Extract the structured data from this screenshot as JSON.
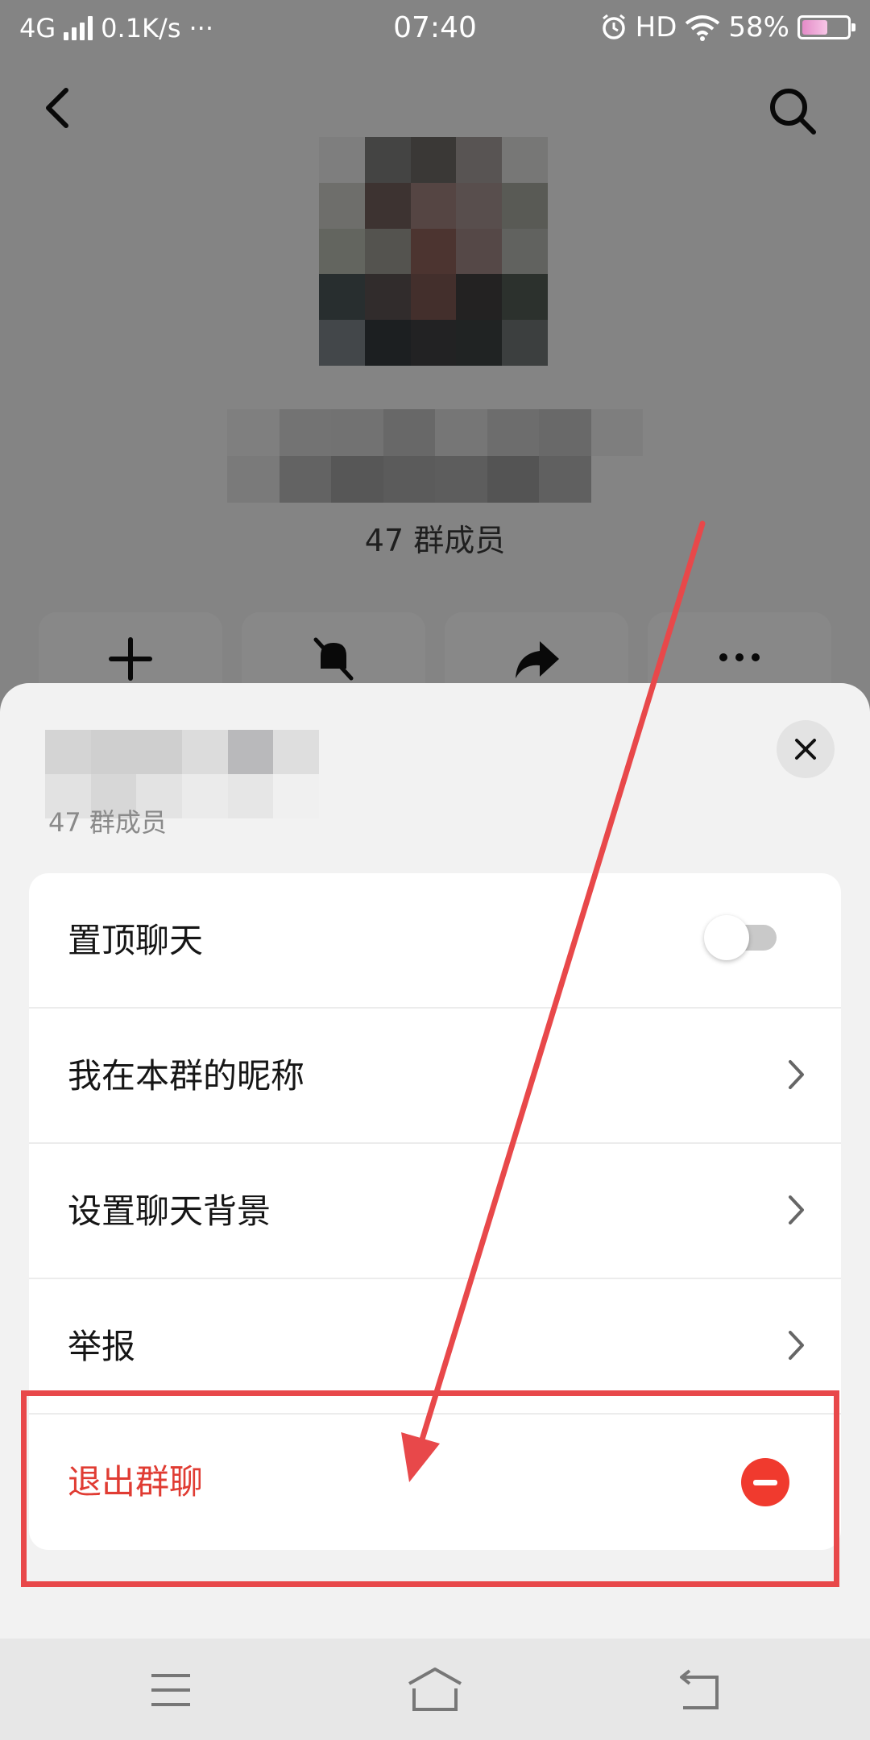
{
  "status_bar": {
    "network": "4G",
    "speed": "0.1K/s",
    "more": "···",
    "time": "07:40",
    "hd": "HD",
    "battery": "58%",
    "battery_level": 0.58
  },
  "header": {
    "back_icon": "chevron-left-icon",
    "search_icon": "search-icon"
  },
  "group": {
    "member_count": "47 群成员"
  },
  "actions": [
    {
      "icon": "plus-icon"
    },
    {
      "icon": "bell-mute-icon"
    },
    {
      "icon": "share-icon"
    },
    {
      "icon": "more-icon"
    }
  ],
  "sheet": {
    "member_count": "47 群成员",
    "close_icon": "close-icon",
    "items": [
      {
        "label": "置顶聊天",
        "control": "toggle",
        "toggle_on": false
      },
      {
        "label": "我在本群的昵称",
        "control": "chevron"
      },
      {
        "label": "设置聊天背景",
        "control": "chevron"
      },
      {
        "label": "举报",
        "control": "chevron"
      },
      {
        "label": "退出群聊",
        "control": "exit",
        "color": "#e03c33"
      }
    ]
  },
  "annotation": {
    "color": "#e8484a"
  },
  "nav_bar": {
    "menu_icon": "menu-icon",
    "home_icon": "home-icon",
    "back_icon": "back-icon"
  }
}
